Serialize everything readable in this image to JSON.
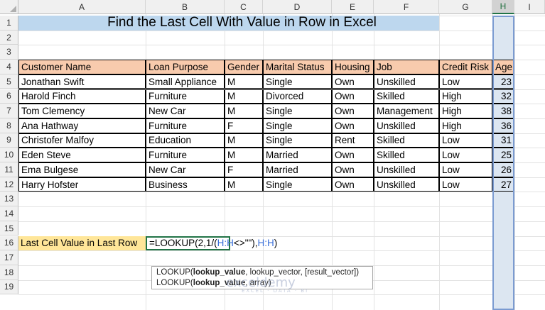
{
  "columns": [
    "A",
    "B",
    "C",
    "D",
    "E",
    "F",
    "G",
    "H",
    "I"
  ],
  "selected_column": "H",
  "rows": [
    "1",
    "2",
    "3",
    "4",
    "5",
    "6",
    "7",
    "8",
    "9",
    "10",
    "11",
    "12",
    "13",
    "14",
    "15",
    "16",
    "17",
    "18",
    "19"
  ],
  "title": "Find the Last Cell With Value in Row in Excel",
  "table": {
    "headers": [
      "Customer Name",
      "Loan Purpose",
      "Gender",
      "Marital Status",
      "Housing",
      "Job",
      "Credit Risk",
      "Age"
    ],
    "rows": [
      [
        "Jonathan Swift",
        "Small Appliance",
        "M",
        "Single",
        "Own",
        "Unskilled",
        "Low",
        "23"
      ],
      [
        "Harold Finch",
        "Furniture",
        "M",
        "Divorced",
        "Own",
        "Skilled",
        "High",
        "32"
      ],
      [
        "Tom Clemency",
        "New Car",
        "M",
        "Single",
        "Own",
        "Management",
        "High",
        "38"
      ],
      [
        "Ana Hathway",
        "Furniture",
        "F",
        "Single",
        "Own",
        "Unskilled",
        "High",
        "36"
      ],
      [
        "Christofer Malfoy",
        "Education",
        "M",
        "Single",
        "Rent",
        "Skilled",
        "Low",
        "31"
      ],
      [
        "Eden Steve",
        "Furniture",
        "M",
        "Married",
        "Own",
        "Skilled",
        "Low",
        "25"
      ],
      [
        "Ema Bulgese",
        "New Car",
        "F",
        "Married",
        "Own",
        "Unskilled",
        "Low",
        "26"
      ],
      [
        "Harry Hofster",
        "Business",
        "M",
        "Single",
        "Own",
        "Unskilled",
        "Low",
        "27"
      ]
    ]
  },
  "answer_label": "Last Cell Value in Last Row",
  "formula": {
    "prefix": "=LOOKUP(2,1/(",
    "ref1": "H:H",
    "middle": "<>\"\"),",
    "ref2": "H:H",
    "suffix": ")"
  },
  "tooltip": {
    "line1_fn": "LOOKUP(",
    "line1_bold": "lookup_value",
    "line1_rest": ", lookup_vector, [result_vector])",
    "line2_fn": "LOOKUP(",
    "line2_bold": "lookup_value",
    "line2_rest": ", array)"
  },
  "watermark": {
    "name": "exceldemy",
    "tagline": "EXCEL · DATA · BI"
  },
  "colors": {
    "title_bg": "#bdd7ee",
    "header_bg": "#f8cbad",
    "answer_bg": "#ffe699",
    "selected_col_bg": "#dce6f1",
    "accent": "#217346"
  }
}
